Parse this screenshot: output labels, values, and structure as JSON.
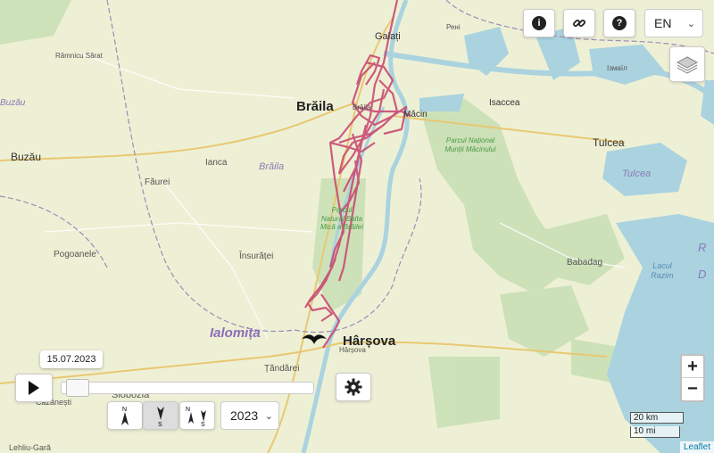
{
  "map": {
    "labels": {
      "galati": "Galați",
      "reni": "Рені",
      "izmail": "Ізмаїл",
      "ramnicu_sarat": "Râmnicu Sărat",
      "braila_city": "Brăila",
      "braila_region": "Brăila",
      "braila_small": "Brăila",
      "macin": "Măcin",
      "isaccea": "Isaccea",
      "tulcea_city": "Tulcea",
      "tulcea_region": "Tulcea",
      "buzau_region": "Buzău",
      "buzau_city": "Buzău",
      "ianca": "Ianca",
      "faurei": "Făurei",
      "park_macin": "Parcul Național Munții Măcinului",
      "park_balta": "Parcul Natural Balta Mică a Brăilei",
      "pogoanele": "Pogoanele",
      "insuratei": "Însurăței",
      "babadag": "Babadag",
      "lake_razim": "Lacul Razim",
      "ialomita": "Ialomița",
      "harsova_city": "Hârșova",
      "harsova_small": "Hârșova",
      "tandarei": "Țăndărei",
      "slobozia": "Slobozia",
      "cazanesti": "Căzănești",
      "lehliu": "Lehliu-Gară",
      "delta_r": "R",
      "delta_d": "D"
    },
    "colors": {
      "track": "#c8426e",
      "water": "#aad3df",
      "forest": "#add19e",
      "farmland": "#eef0d5",
      "border": "#9e8bb8"
    }
  },
  "controls": {
    "info_icon": "i",
    "help_icon": "?",
    "language": "EN",
    "zoom_in": "+",
    "zoom_out": "−",
    "date_tooltip": "15.07.2023",
    "year": "2023",
    "orient_n": "N",
    "orient_s": "S",
    "scale_km": "20 km",
    "scale_mi": "10 mi",
    "attribution": "Leaflet",
    "playback_progress": 0.01
  }
}
